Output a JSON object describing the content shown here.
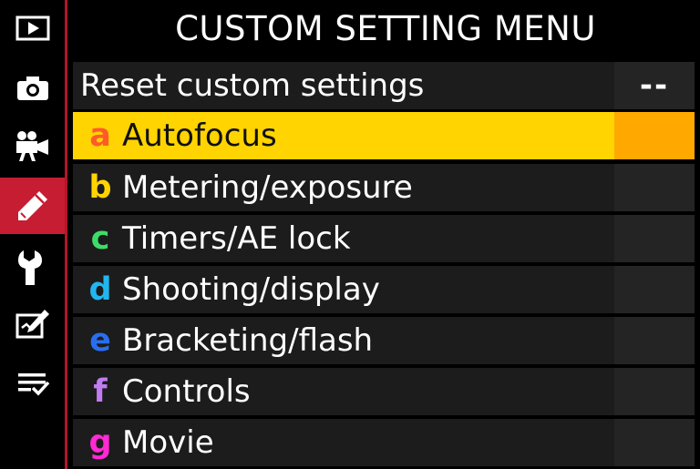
{
  "header": {
    "title": "CUSTOM SETTING MENU"
  },
  "sidebar": {
    "items": [
      {
        "icon": "playback-icon"
      },
      {
        "icon": "camera-icon"
      },
      {
        "icon": "movie-camera-icon"
      },
      {
        "icon": "pencil-icon"
      },
      {
        "icon": "wrench-icon"
      },
      {
        "icon": "retouch-icon"
      },
      {
        "icon": "my-menu-icon"
      }
    ]
  },
  "menu": {
    "reset": {
      "label": "Reset custom settings",
      "value": "--"
    },
    "items": [
      {
        "letter": "a",
        "label": "Autofocus",
        "color": "#ff5a2c"
      },
      {
        "letter": "b",
        "label": "Metering/exposure",
        "color": "#ffd400"
      },
      {
        "letter": "c",
        "label": "Timers/AE lock",
        "color": "#3ddc6a"
      },
      {
        "letter": "d",
        "label": "Shooting/display",
        "color": "#22b6f0"
      },
      {
        "letter": "e",
        "label": "Bracketing/flash",
        "color": "#2a6ef0"
      },
      {
        "letter": "f",
        "label": "Controls",
        "color": "#c07cf0"
      },
      {
        "letter": "g",
        "label": "Movie",
        "color": "#ff2ad4"
      }
    ]
  },
  "colors": {
    "sidebar_active": "#c61d32",
    "selection": "#ffd400",
    "selection_side": "#ffa800",
    "row_background": "#1c1c1c"
  }
}
